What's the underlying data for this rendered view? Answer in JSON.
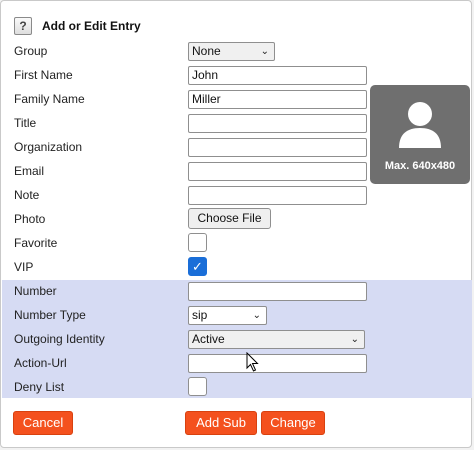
{
  "dialog": {
    "title": "Add or Edit Entry",
    "help_icon": "?"
  },
  "fields": {
    "group": {
      "label": "Group",
      "value": "None"
    },
    "first_name": {
      "label": "First Name",
      "value": "John"
    },
    "family_name": {
      "label": "Family Name",
      "value": "Miller"
    },
    "title": {
      "label": "Title",
      "value": ""
    },
    "organization": {
      "label": "Organization",
      "value": ""
    },
    "email": {
      "label": "Email",
      "value": ""
    },
    "note": {
      "label": "Note",
      "value": ""
    },
    "photo": {
      "label": "Photo",
      "button": "Choose File",
      "preview_caption": "Max. 640x480"
    },
    "favorite": {
      "label": "Favorite",
      "checked": false
    },
    "vip": {
      "label": "VIP",
      "checked": true,
      "check_glyph": "✓"
    },
    "number": {
      "label": "Number",
      "value": ""
    },
    "number_type": {
      "label": "Number Type",
      "value": "sip"
    },
    "outgoing_identity": {
      "label": "Outgoing Identity",
      "value": "Active"
    },
    "action_url": {
      "label": "Action-Url",
      "value": ""
    },
    "deny_list": {
      "label": "Deny List",
      "checked": false
    }
  },
  "buttons": {
    "cancel": "Cancel",
    "add_sub": "Add Sub",
    "change": "Change"
  },
  "colors": {
    "accent": "#f4511e",
    "band": "#d6dbf3",
    "check": "#1a6ed8"
  },
  "icons": {
    "select_caret": "⌄",
    "avatar": "person-silhouette-icon"
  }
}
